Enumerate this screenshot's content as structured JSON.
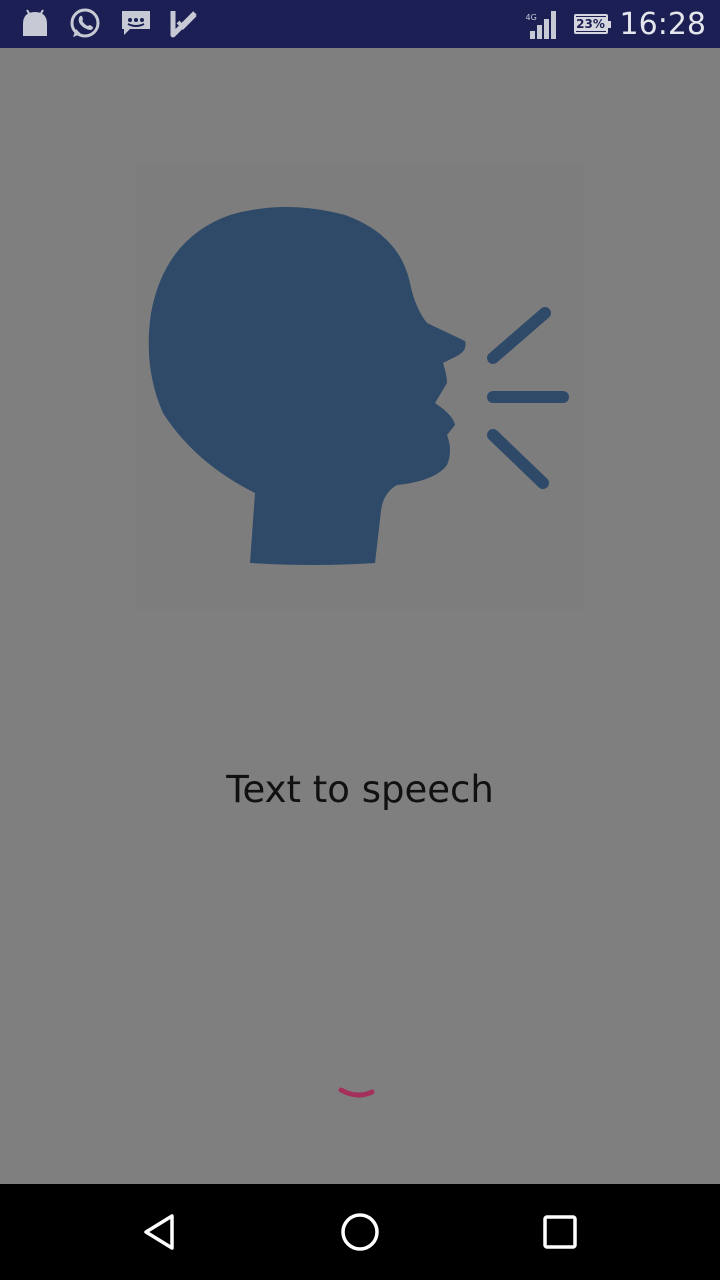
{
  "status_bar": {
    "icons": [
      "android-notification-icon",
      "whatsapp-icon",
      "message-icon",
      "task-check-icon"
    ],
    "network_type": "4G",
    "battery": "23%",
    "time": "16:28"
  },
  "main": {
    "logo": "speaking-head-icon",
    "title": "Text to speech"
  },
  "loading": {
    "indicator": "spinner-icon",
    "color": "#a4305b"
  },
  "nav_bar": {
    "buttons": [
      "back-icon",
      "home-icon",
      "recents-icon"
    ]
  },
  "colors": {
    "status_bar": "#1b1f54",
    "background": "#7f7f7f",
    "logo_fill": "#2e4a68",
    "nav_bar": "#000000"
  }
}
